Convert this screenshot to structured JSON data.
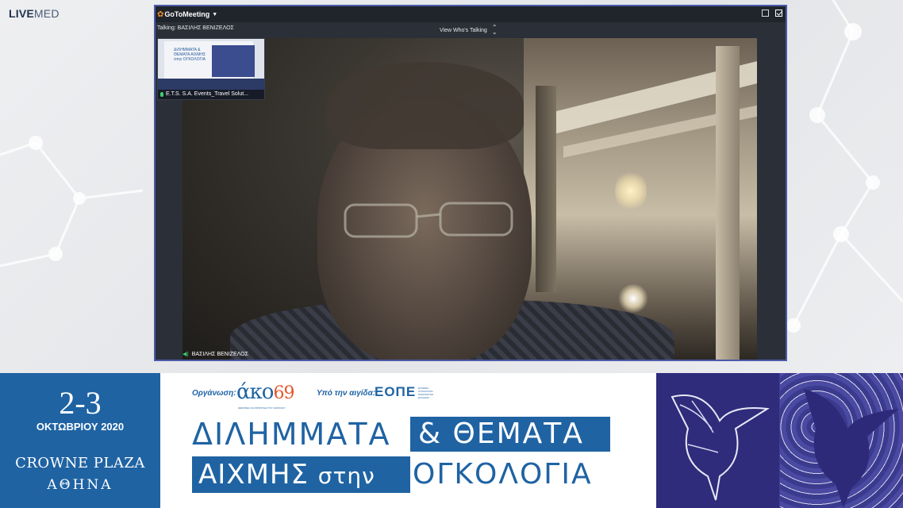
{
  "brand": {
    "live": "LIVE",
    "med": "MED"
  },
  "meeting": {
    "app_name": "GoToMeeting",
    "talking_label": "Talking: ΒΑΣΙΛΗΣ ΒΕΝΙΖΕΛΟΣ",
    "view_whos_talking": "View Who's Talking",
    "thumbnail_label": "E.T.S. S.A. Events_Travel Solut...",
    "speaker_name": "ΒΑΣΙΛΗΣ ΒΕΝΙΖΕΛΟΣ",
    "thumb_banner_text": "ΔΙΛΗΜΜΑΤΑ & ΘΕΜΑΤΑ ΑΙΧΜΗΣ στην ΟΓΚΟΛΟΓΙΑ"
  },
  "event": {
    "dates": "2-3",
    "month": "ΟΚΤΩΒΡΙΟΥ 2020",
    "venue": "CROWNE PLAZA",
    "city": "ΑΘΗΝΑ",
    "organizer_label": "Οργάνωση:",
    "organizer_logo": "άκο",
    "organizer_logo_num": "69",
    "organizer_sub": "ΘΕΡΑΠΕΙΑ ΚΑΙ ΦΡΟΝΤΙΔΑ ΤΟΥ ΚΑΡΚΙΝΟΥ",
    "aegis_label": "Υπό την αιγίδα:",
    "aegis_logo": "ΕΟΠΕ",
    "aegis_sub": "ΕΤΑΙΡΕΙΑ ΟΓΚΟΛΟΓΩΝ ΠΑΘΟΛΟΓΩΝ ΕΛΛΑΔΑΣ",
    "title_line1_a": "ΔΙΛΗΜΜΑΤΑ",
    "title_line1_b": "& ΘΕΜΑΤΑ",
    "title_line2_a": "ΑΙΧΜΗΣ",
    "title_line2_small": "στην",
    "title_line2_b": "ΟΓΚΟΛΟΓΙΑ"
  },
  "colors": {
    "accent_blue": "#1f63a3",
    "window_border": "#4b5aa8",
    "talking_green": "#3ccf72",
    "goto_orange": "#f39323"
  },
  "icons": [
    "gotomeeting-logo-icon",
    "caret-down-icon",
    "sort-arrows-icon",
    "window-restore-icon",
    "checkmark-icon",
    "microphone-icon",
    "speaker-icon"
  ]
}
